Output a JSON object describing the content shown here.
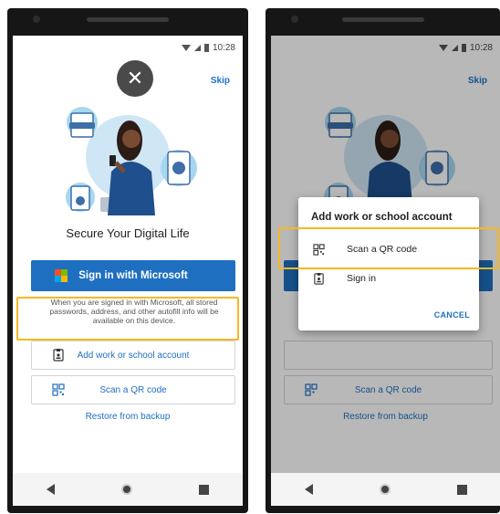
{
  "left": {
    "status_time": "10:28",
    "skip_label": "Skip",
    "title": "Secure Your Digital Life",
    "signin_microsoft_label": "Sign in with Microsoft",
    "info_text": "When you are signed in with Microsoft, all stored passwords, address, and other autofill info will be available on this device.",
    "add_account_label": "Add work or school account",
    "scan_qr_label": "Scan a QR code",
    "restore_label": "Restore from backup",
    "close_glyph": "✕"
  },
  "right": {
    "status_time": "10:28",
    "skip_label": "Skip",
    "dialog": {
      "title": "Add work or school account",
      "options": [
        "Scan a QR code",
        "Sign in"
      ],
      "cancel_label": "CANCEL"
    },
    "scan_qr_label": "Scan a QR code",
    "restore_label": "Restore from backup"
  },
  "colors": {
    "accent": "#1f6fc1",
    "highlight": "#f5b921",
    "ms_logo": [
      "#f25022",
      "#7fba00",
      "#00a4ef",
      "#ffb900"
    ]
  },
  "icons": {
    "qr": "qr-code-icon",
    "badge": "work-badge-icon",
    "close": "close-icon",
    "back": "back-nav-icon",
    "home": "home-nav-icon",
    "recent": "recent-apps-icon"
  }
}
